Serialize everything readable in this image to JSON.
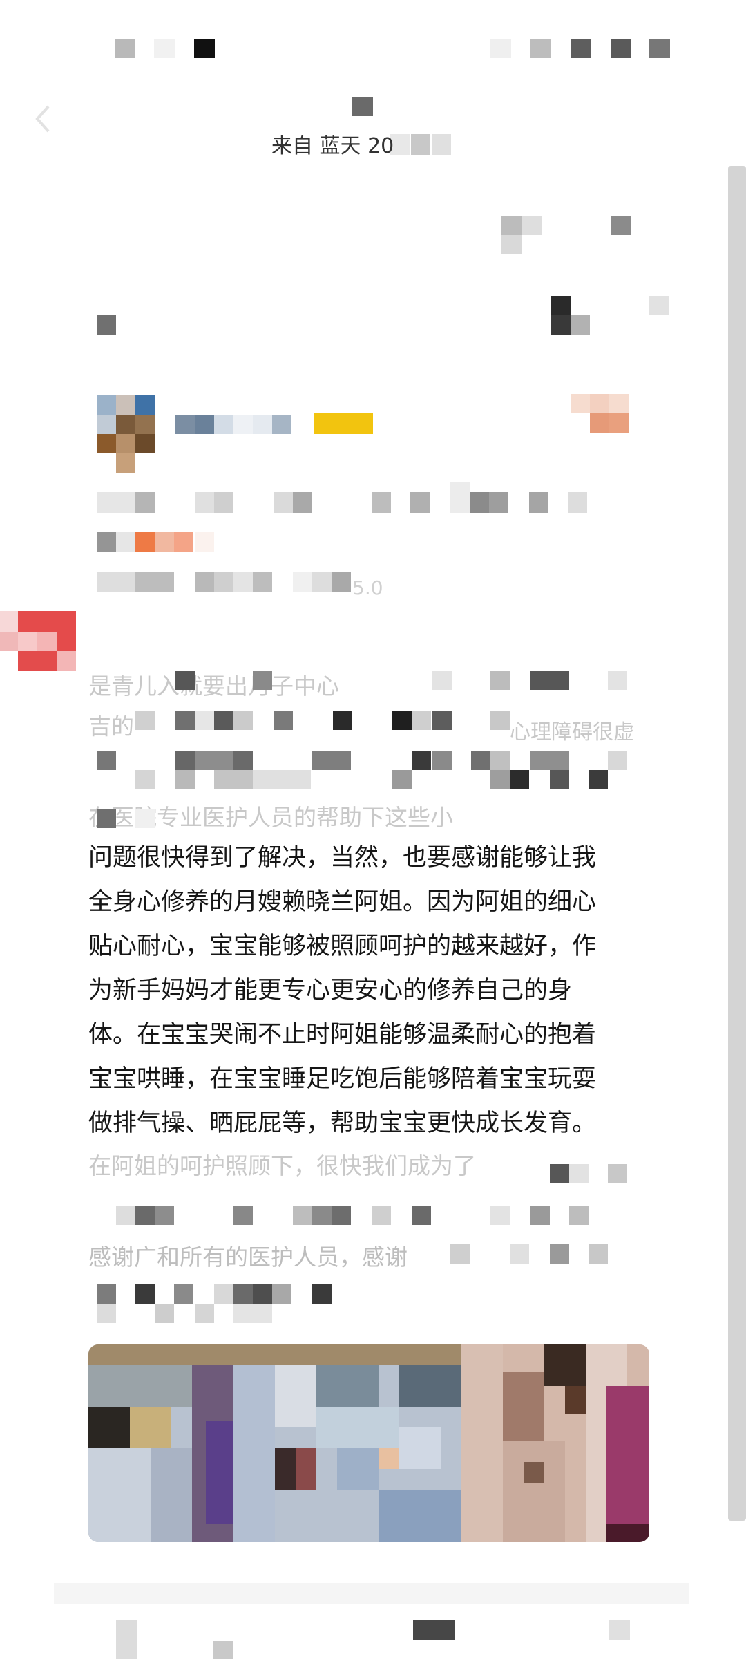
{
  "header": {
    "from_label": "来自 蓝天 20"
  },
  "post": {
    "version_fragment": "5.0",
    "faded_fragments": {
      "line1": "是青儿入就要出月子中心",
      "line2": "吉的",
      "line2_right": "心理障碍很虚",
      "line3": "在医院专业医护人员的帮助下这些小"
    },
    "body_lines": [
      "问题很快得到了解决，当然，也要感谢能够让我",
      "全身心修养的月嫂赖晓兰阿姐。因为阿姐的细心",
      "贴心耐心，宝宝能够被照顾呵护的越来越好，作",
      "为新手妈妈才能更专心更安心的修养自己的身",
      "体。在宝宝哭闹不止时阿姐能够温柔耐心的抱着",
      "宝宝哄睡，在宝宝睡足吃饱后能够陪着宝宝玩耍",
      "做排气操、晒屁屁等，帮助宝宝更快成长发育。"
    ],
    "after_fragments": {
      "line1": "在阿姐的呵护照顾下，很快我们成为了",
      "line2": "感谢广和所有的医护人员，感谢"
    }
  },
  "icons": {
    "back": "back-arrow-icon",
    "share": "share-icon"
  }
}
